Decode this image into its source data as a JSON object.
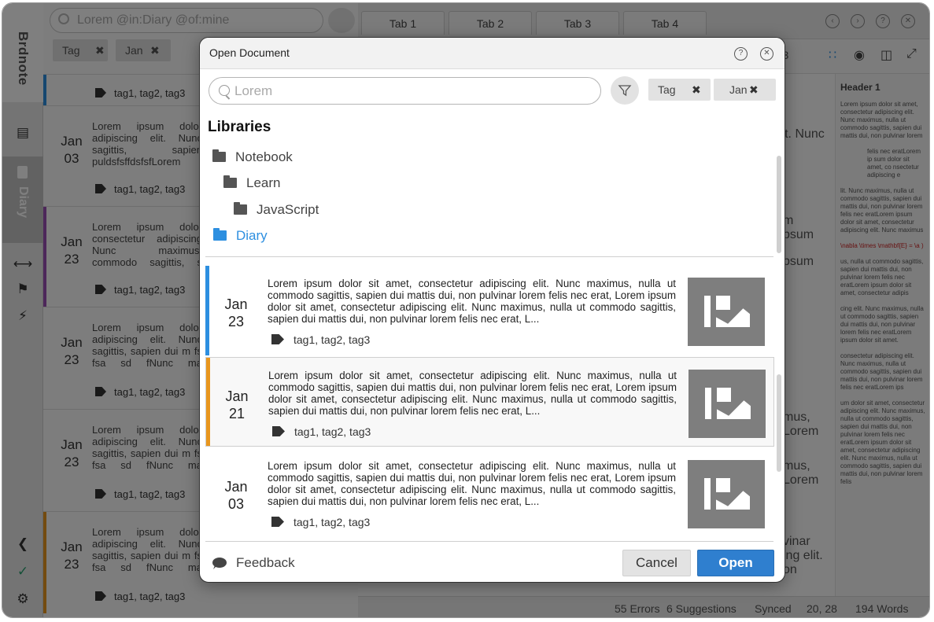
{
  "app": {
    "name": "Brdnote",
    "nav_diary_label": "Diary"
  },
  "background": {
    "search_placeholder": "Lorem @in:Diary @of:mine",
    "chips": [
      {
        "label": "Tag"
      },
      {
        "label": "Jan"
      }
    ],
    "tabs": [
      "Tab 1",
      "Tab 2",
      "Tab 3",
      "Tab 4"
    ],
    "toolbar_tags": "tag3",
    "list": [
      {
        "date_month": "",
        "date_day": "",
        "text": "",
        "tags": "tag1, tag2, tag3",
        "color": "#2d8fe0"
      },
      {
        "date_month": "Jan",
        "date_day": "03",
        "text": "Lorem ipsum dolor adipiscing elit. Nunc sagittis, sapien puldsfsffdsfsfLorem consectetur adipiscing",
        "tags": "tag1, tag2, tag3",
        "color": ""
      },
      {
        "date_month": "Jan",
        "date_day": "23",
        "text": "Lorem ipsum dolor consectetur adipiscing Nunc maximus, commodo sagittis, s mattis dui, non puldsf",
        "tags": "tag1, tag2, tag3",
        "color": "#9b4fb5"
      },
      {
        "date_month": "Jan",
        "date_day": "23",
        "text": "Lorem ipsum dolor adipiscing elit. Nunc sagittis, sapien dui m fs fsa sd fNunc ma sagittis, sapien dui m",
        "tags": "tag1, tag2, tag3",
        "color": ""
      },
      {
        "date_month": "Jan",
        "date_day": "23",
        "text": "Lorem ipsum dolor adipiscing elit. Nunc sagittis, sapien dui m fs fsa sd fNunc ma sagittis, sapien dui m",
        "tags": "tag1, tag2, tag3",
        "color": ""
      },
      {
        "date_month": "Jan",
        "date_day": "23",
        "text": "Lorem ipsum dolor adipiscing elit. Nunc sagittis, sapien dui m fs fsa sd fNunc ma sagittis, sapien dui m",
        "tags": "tag1, tag2, tag3",
        "color": "#e8961e"
      }
    ],
    "editor_fragments": [
      "lit. Nunc",
      "m",
      "psum",
      "psum",
      "mus,",
      "Lorem",
      "mus,",
      "Lorem",
      "vinar",
      "ing elit.",
      "on"
    ],
    "preview": {
      "header": "Header 1",
      "p1": "Lorem ipsum dolor sit amet, consectetur adipiscing elit. Nunc maximus, nulla ut commodo sagittis, sapien dui mattis dui, non pulvinar lorem",
      "bullets": "felis nec eratLorem ip sum dolor sit amet, co nsectetur adipiscing e",
      "p2": "lit. Nunc maximus, nulla ut commodo sagittis, sapien dui mattis dui, non pulvinar lorem felis nec eratLorem ipsum dolor sit amet, consectetur adipiscing elit. Nunc maximus",
      "formula": "\\nabla \\times \\mathbf{E} = \\a )",
      "p3": "us, nulla ut commodo sagittis, sapien dui mattis dui, non pulvinar lorem felis nec eratLorem ipsum dolor sit amet, consectetur adipis",
      "p4": "cing elit. Nunc maximus, nulla ut commodo sagittis, sapien dui mattis dui, non pulvinar lorem felis nec eratLorem ipsum dolor sit amet.",
      "p5": "consectetur adipiscing elit. Nunc maximus, nulla ut commodo sagittis, sapien dui mattis dui, non pulvinar lorem felis nec eratLorem ips",
      "p6": "um dolor sit amet, consectetur adipiscing elit. Nunc maximus, nulla ut commodo sagittis, sapien dui mattis dui, non pulvinar lorem felis nec eratLorem ipsum dolor sit amet, consectetur adipiscing elit. Nunc maximus, nulla ut commodo sagittis, sapien dui mattis dui, non pulvinar lorem felis"
    },
    "status": {
      "errors": "55 Errors",
      "suggestions": "6 Suggestions",
      "synced": "Synced",
      "position": "20, 28",
      "words": "194 Words"
    }
  },
  "dialog": {
    "title": "Open Document",
    "search_placeholder": "Lorem",
    "chips": [
      {
        "label": "Tag"
      },
      {
        "label": "Jan"
      }
    ],
    "libraries_heading": "Libraries",
    "tree": [
      {
        "label": "Notebook",
        "level": 0,
        "active": false
      },
      {
        "label": "Learn",
        "level": 1,
        "active": false
      },
      {
        "label": "JavaScript",
        "level": 2,
        "active": false
      },
      {
        "label": "Diary",
        "level": 0,
        "active": true
      }
    ],
    "documents": [
      {
        "month": "Jan",
        "day": "23",
        "text": "Lorem ipsum dolor sit amet, consectetur adipiscing elit. Nunc maximus, nulla ut commodo sagittis, sapien dui mattis dui, non pulvinar lorem felis nec erat, Lorem ipsum dolor sit amet, consectetur adipiscing elit. Nunc maximus, nulla ut commodo sagittis, sapien dui mattis dui, non pulvinar lorem felis nec erat, L...",
        "tags": "tag1, tag2, tag3",
        "color": "#2d8fe0",
        "selected": false
      },
      {
        "month": "Jan",
        "day": "21",
        "text": "Lorem ipsum dolor sit amet, consectetur adipiscing elit. Nunc maximus, nulla ut commodo sagittis, sapien dui mattis dui, non pulvinar lorem felis nec erat, Lorem ipsum dolor sit amet, consectetur adipiscing elit. Nunc maximus, nulla ut commodo sagittis, sapien dui mattis dui, non pulvinar lorem felis nec erat, L...",
        "tags": "tag1, tag2, tag3",
        "color": "#e8961e",
        "selected": true
      },
      {
        "month": "Jan",
        "day": "03",
        "text": "Lorem ipsum dolor sit amet, consectetur adipiscing elit. Nunc maximus, nulla ut commodo sagittis, sapien dui mattis dui, non pulvinar lorem felis nec erat, Lorem ipsum dolor sit amet, consectetur adipiscing elit. Nunc maximus, nulla ut commodo sagittis, sapien dui mattis dui, non pulvinar lorem felis nec erat, L...",
        "tags": "tag1, tag2, tag3",
        "color": "",
        "selected": false
      }
    ],
    "feedback_label": "Feedback",
    "cancel_label": "Cancel",
    "open_label": "Open"
  },
  "icons": {
    "help": "question-circle-icon",
    "close": "close-circle-icon",
    "filter": "filter-icon",
    "folder": "folder-icon",
    "tag": "tag-icon",
    "image": "image-placeholder-icon",
    "feedback": "speech-bubble-icon"
  }
}
